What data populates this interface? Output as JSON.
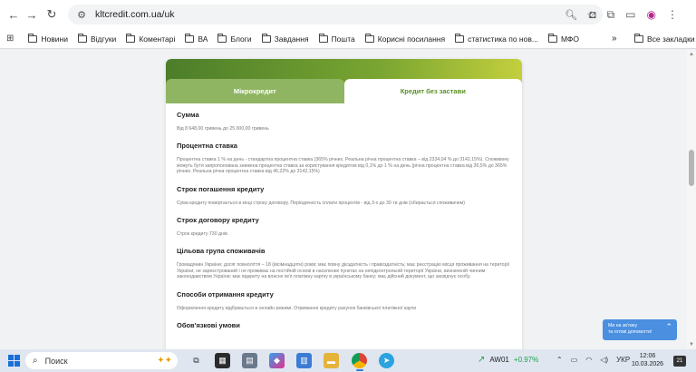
{
  "browser": {
    "url": "kltcredit.com.ua/uk",
    "bookmarks": [
      "Новини",
      "Відгуки",
      "Коментарі",
      "ВА",
      "Блоги",
      "Завдання",
      "Пошта",
      "Корисні посилання",
      "статистика по нов...",
      "МФО"
    ],
    "all_bookmarks": "Все закладки",
    "more": "»"
  },
  "card": {
    "tabs": [
      {
        "label": "Мікрокредит",
        "active": false
      },
      {
        "label": "Кредит без застави",
        "active": true
      }
    ],
    "sections": [
      {
        "title": "Сумма",
        "text": "Від 8 648,00 гривень до 25 000,00 гривень"
      },
      {
        "title": "Процентна ставка",
        "text": "Процентна ставка 1 % на день - стандартна процентна ставка (365% річних. Реальна річна процентна ставка – від 2334,04 % до 3142,15%). Споживачу можуть бути запропонована знижена процентна ставка за користування кредитом від 0,1% до 1 % на день (річна процентна ставка від 36,5% до 365% річних. Реальна річна процентна ставка від 46,22% до 3142,15%)"
      },
      {
        "title": "Строк погашення кредиту",
        "text": "Сума кредиту повертається в кінці строку договору. Періодичність сплати процентів - від 3-х до 30 ти днів (обирається споживачем)"
      },
      {
        "title": "Строк договору кредиту",
        "text": "Строк кредиту 730 днів"
      },
      {
        "title": "Цільова група споживачів",
        "text": "Громадянин України; досяг повноліття – 18 (вісімнадцяти) років; має повну дієздатність і правоздатність; має реєстрацію місця проживання на території України; не зареєстрований і не проживає на постійній основі в населених пунктах на непідконтрольній території України, визначеній чинним законодавством України; має відкриту на власне ім'я платіжну картку в українському банку; має дійсний документ, що засвідчує особу."
      },
      {
        "title": "Способи отримання кредиту",
        "text": "Оформлення кредиту відбувається в онлайн режимі. Отримання кредиту рахунок банківської платіжної карти"
      },
      {
        "title": "Обов'язкові умови",
        "text": ""
      }
    ]
  },
  "chat": {
    "line1": "Ми на зв'язку",
    "line2": "та готові допомогти!"
  },
  "taskbar": {
    "search_placeholder": "Поиск",
    "stock_name": "AW01",
    "stock_change": "+0.97%",
    "language": "УКР",
    "time": "12:06",
    "date": "10.03.2026",
    "notifications": "21"
  },
  "colors": {
    "accent_green": "#5a8f24",
    "chat_blue": "#4a8fe0"
  }
}
